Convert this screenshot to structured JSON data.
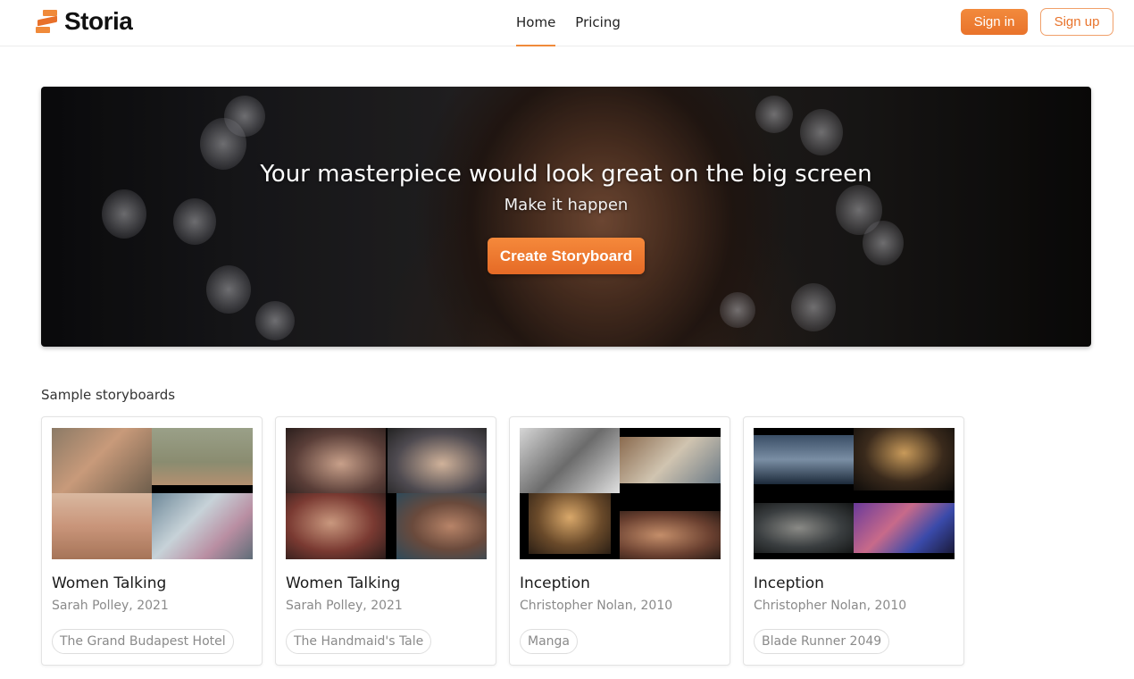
{
  "brand": {
    "name": "Storia",
    "logo_icon": "storia-logo-icon",
    "accent": "#f08a3a"
  },
  "nav": {
    "items": [
      {
        "label": "Home",
        "active": true
      },
      {
        "label": "Pricing",
        "active": false
      }
    ]
  },
  "auth": {
    "signin_label": "Sign in",
    "signup_label": "Sign up"
  },
  "hero": {
    "title": "Your masterpiece would look great on the big screen",
    "subtitle": "Make it happen",
    "cta_label": "Create Storyboard"
  },
  "samples": {
    "heading": "Sample storyboards",
    "cards": [
      {
        "title": "Women Talking",
        "meta": "Sarah Polley, 2021",
        "tag": "The Grand Budapest Hotel"
      },
      {
        "title": "Women Talking",
        "meta": "Sarah Polley, 2021",
        "tag": "The Handmaid's Tale"
      },
      {
        "title": "Inception",
        "meta": "Christopher Nolan, 2010",
        "tag": "Manga"
      },
      {
        "title": "Inception",
        "meta": "Christopher Nolan, 2010",
        "tag": "Blade Runner 2049"
      }
    ]
  }
}
